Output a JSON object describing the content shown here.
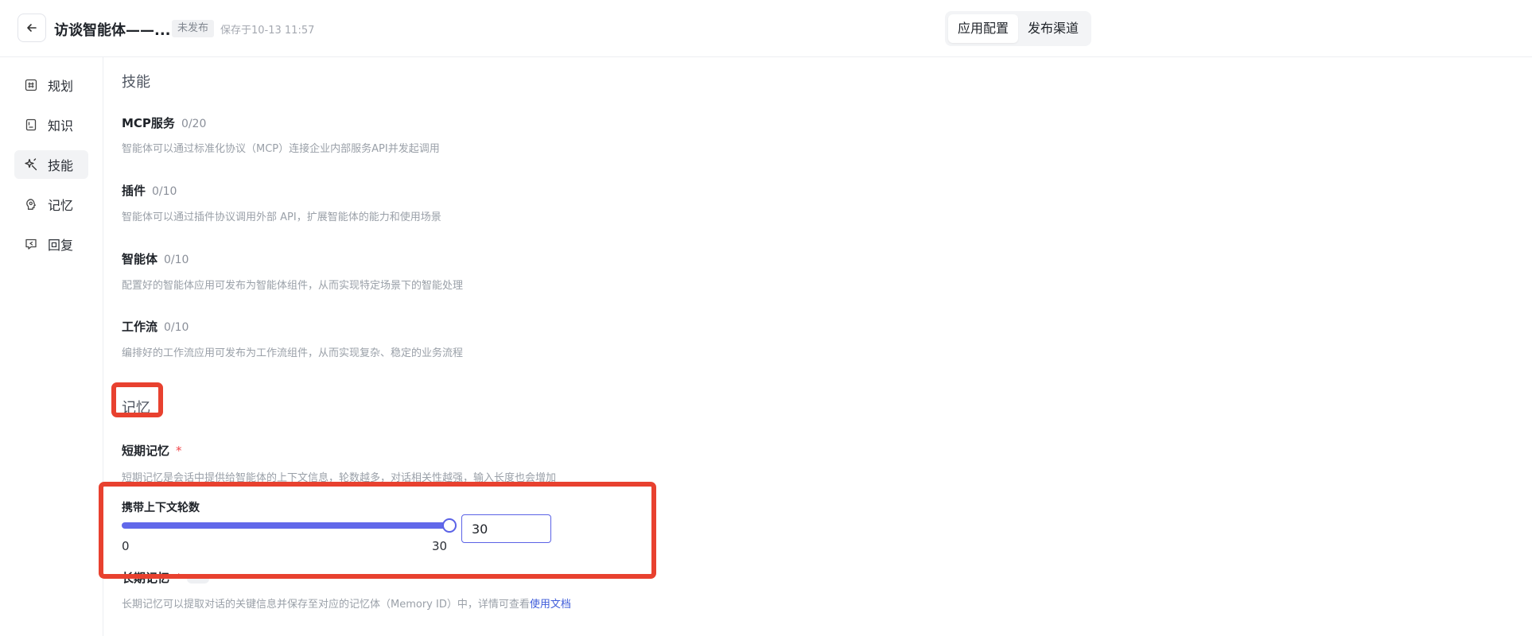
{
  "header": {
    "title": "访谈智能体——...",
    "status": "未发布",
    "save_time": "保存于10-13 11:57",
    "tabs": [
      {
        "label": "应用配置",
        "active": true
      },
      {
        "label": "发布渠道",
        "active": false
      }
    ]
  },
  "sidebar": {
    "items": [
      {
        "label": "规划",
        "icon": "hash-icon"
      },
      {
        "label": "知识",
        "icon": "book-icon"
      },
      {
        "label": "技能",
        "icon": "sparkle-icon",
        "active": true
      },
      {
        "label": "记忆",
        "icon": "brain-icon"
      },
      {
        "label": "回复",
        "icon": "reply-icon"
      }
    ]
  },
  "skills": {
    "title": "技能",
    "items": [
      {
        "name": "MCP服务",
        "count": "0/20",
        "desc": "智能体可以通过标准化协议（MCP）连接企业内部服务API并发起调用"
      },
      {
        "name": "插件",
        "count": "0/10",
        "desc": "智能体可以通过插件协议调用外部 API，扩展智能体的能力和使用场景"
      },
      {
        "name": "智能体",
        "count": "0/10",
        "desc": "配置好的智能体应用可发布为智能体组件，从而实现特定场景下的智能处理"
      },
      {
        "name": "工作流",
        "count": "0/10",
        "desc": "编排好的工作流应用可发布为工作流组件，从而实现复杂、稳定的业务流程"
      }
    ]
  },
  "memory": {
    "title": "记忆",
    "short_term": {
      "title": "短期记忆",
      "required": "*",
      "desc": "短期记忆是会话中提供给智能体的上下文信息，轮数越多，对话相关性越强，输入长度也会增加",
      "slider_label": "携带上下文轮数",
      "min": "0",
      "max": "30",
      "value": "30",
      "value_fraction": 1.0
    },
    "long_term": {
      "title": "长期记忆",
      "required": "*",
      "desc": "长期记忆可以提取对话的关键信息并保存至对应的记忆体（Memory ID）中，详情可查看",
      "link": "使用文档"
    }
  },
  "colors": {
    "accent": "#5b62e6",
    "annotation": "#e8412f"
  }
}
